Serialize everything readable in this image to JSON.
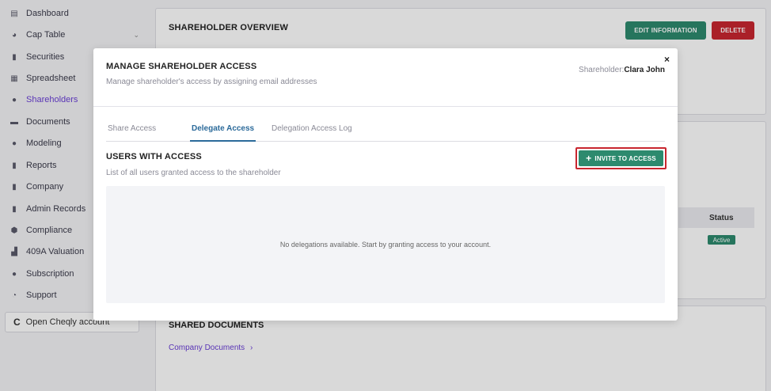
{
  "sidebar": {
    "items": [
      {
        "label": "Dashboard",
        "icon": "dashboard-icon"
      },
      {
        "label": "Cap Table",
        "icon": "pie-chart-icon"
      },
      {
        "label": "Securities",
        "icon": "clipboard-icon"
      },
      {
        "label": "Spreadsheet",
        "icon": "grid-icon"
      },
      {
        "label": "Shareholders",
        "icon": "user-icon"
      },
      {
        "label": "Documents",
        "icon": "folder-icon"
      },
      {
        "label": "Modeling",
        "icon": "bulb-icon"
      },
      {
        "label": "Reports",
        "icon": "report-icon"
      },
      {
        "label": "Company",
        "icon": "building-icon"
      },
      {
        "label": "Admin Records",
        "icon": "records-icon"
      },
      {
        "label": "Compliance",
        "icon": "shield-icon"
      },
      {
        "label": "409A Valuation",
        "icon": "chart-icon"
      },
      {
        "label": "Subscription",
        "icon": "dollar-icon"
      },
      {
        "label": "Support",
        "icon": "support-icon"
      }
    ],
    "cheqly_label": "Open Cheqly account"
  },
  "overview": {
    "title": "SHAREHOLDER OVERVIEW",
    "edit_label": "EDIT INFORMATION",
    "delete_label": "DELETE",
    "status_header": "Status",
    "status_value": "Active"
  },
  "docs": {
    "title": "SHARED DOCUMENTS",
    "link": "Company Documents",
    "link_chevron": "›"
  },
  "modal": {
    "title": "MANAGE SHAREHOLDER ACCESS",
    "subtitle": "Manage shareholder's access by assigning email addresses",
    "shareholder_label": "Shareholder:",
    "shareholder_name": "Clara John",
    "close": "×",
    "tabs": [
      {
        "label": "Share Access"
      },
      {
        "label": "Delegate Access"
      },
      {
        "label": "Delegation Access Log"
      }
    ],
    "users_title": "USERS WITH ACCESS",
    "users_subtitle": "List of all users granted access to the shareholder",
    "invite_label": "INVITE TO ACCESS",
    "invite_plus": "+",
    "empty_text": "No delegations available. Start by granting access to your account."
  },
  "colors": {
    "accent_green": "#2d8a6e",
    "danger_red": "#c8262f",
    "active_purple": "#6a3fd6",
    "tab_blue": "#2b6a9a"
  }
}
